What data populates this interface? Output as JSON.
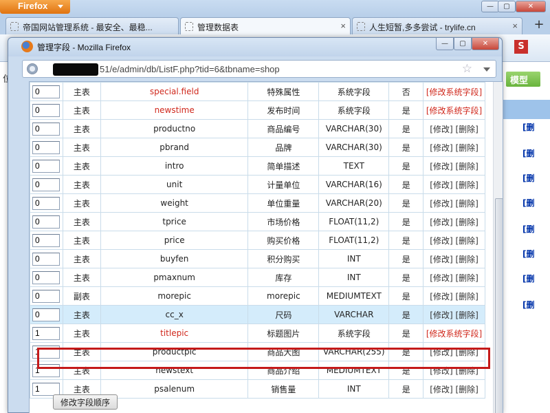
{
  "browser": {
    "firefox_button": "Firefox",
    "tabs": [
      {
        "title": "帝国网站管理系统 - 最安全、最稳..."
      },
      {
        "title": "管理数据表"
      },
      {
        "title": "人生短暂,多多尝试 - trylife.cn"
      }
    ],
    "new_tab": "+",
    "tab_close": "×"
  },
  "background": {
    "left_char": "位",
    "green_button": "模型",
    "s_icon": "S",
    "row_link": "[删"
  },
  "popup": {
    "title": "管理字段 - Mozilla Firefox",
    "url": "51/e/admin/db/ListF.php?tid=6&tbname=shop",
    "win_min": "—",
    "win_max": "▢",
    "win_close": "✕"
  },
  "table": {
    "rows": [
      {
        "order": "0",
        "table": "主表",
        "field": "special.field",
        "label": "特殊属性",
        "type": "系统字段",
        "enabled": "否",
        "actions": "[修改系统字段]",
        "system": true
      },
      {
        "order": "0",
        "table": "主表",
        "field": "newstime",
        "label": "发布时间",
        "type": "系统字段",
        "enabled": "是",
        "actions": "[修改系统字段]",
        "system": true
      },
      {
        "order": "0",
        "table": "主表",
        "field": "productno",
        "label": "商品编号",
        "type": "VARCHAR(30)",
        "enabled": "是",
        "actions": "[修改] [删除]",
        "system": false
      },
      {
        "order": "0",
        "table": "主表",
        "field": "pbrand",
        "label": "品牌",
        "type": "VARCHAR(30)",
        "enabled": "是",
        "actions": "[修改] [删除]",
        "system": false
      },
      {
        "order": "0",
        "table": "主表",
        "field": "intro",
        "label": "简单描述",
        "type": "TEXT",
        "enabled": "是",
        "actions": "[修改] [删除]",
        "system": false
      },
      {
        "order": "0",
        "table": "主表",
        "field": "unit",
        "label": "计量单位",
        "type": "VARCHAR(16)",
        "enabled": "是",
        "actions": "[修改] [删除]",
        "system": false
      },
      {
        "order": "0",
        "table": "主表",
        "field": "weight",
        "label": "单位重量",
        "type": "VARCHAR(20)",
        "enabled": "是",
        "actions": "[修改] [删除]",
        "system": false
      },
      {
        "order": "0",
        "table": "主表",
        "field": "tprice",
        "label": "市场价格",
        "type": "FLOAT(11,2)",
        "enabled": "是",
        "actions": "[修改] [删除]",
        "system": false
      },
      {
        "order": "0",
        "table": "主表",
        "field": "price",
        "label": "购买价格",
        "type": "FLOAT(11,2)",
        "enabled": "是",
        "actions": "[修改] [删除]",
        "system": false
      },
      {
        "order": "0",
        "table": "主表",
        "field": "buyfen",
        "label": "积分购买",
        "type": "INT",
        "enabled": "是",
        "actions": "[修改] [删除]",
        "system": false
      },
      {
        "order": "0",
        "table": "主表",
        "field": "pmaxnum",
        "label": "库存",
        "type": "INT",
        "enabled": "是",
        "actions": "[修改] [删除]",
        "system": false
      },
      {
        "order": "0",
        "table": "副表",
        "field": "morepic",
        "label": "morepic",
        "type": "MEDIUMTEXT",
        "enabled": "是",
        "actions": "[修改] [删除]",
        "system": false
      },
      {
        "order": "0",
        "table": "主表",
        "field": "cc_x",
        "label": "尺码",
        "type": "VARCHAR",
        "enabled": "是",
        "actions": "[修改] [删除]",
        "system": false,
        "highlight": true
      },
      {
        "order": "1",
        "table": "主表",
        "field": "titlepic",
        "label": "标题图片",
        "type": "系统字段",
        "enabled": "是",
        "actions": "[修改系统字段]",
        "system": true
      },
      {
        "order": "1",
        "table": "主表",
        "field": "productpic",
        "label": "商品大图",
        "type": "VARCHAR(255)",
        "enabled": "是",
        "actions": "[修改] [删除]",
        "system": false
      },
      {
        "order": "1",
        "table": "主表",
        "field": "newstext",
        "label": "商品介绍",
        "type": "MEDIUMTEXT",
        "enabled": "是",
        "actions": "[修改] [删除]",
        "system": false
      },
      {
        "order": "1",
        "table": "主表",
        "field": "psalenum",
        "label": "销售量",
        "type": "INT",
        "enabled": "是",
        "actions": "[修改] [删除]",
        "system": false
      }
    ],
    "order_button": "修改字段顺序"
  },
  "colors": {
    "system_field_red": "#d0281c",
    "highlight_border": "#c41a1a",
    "highlight_bg": "#d4ecfb"
  }
}
